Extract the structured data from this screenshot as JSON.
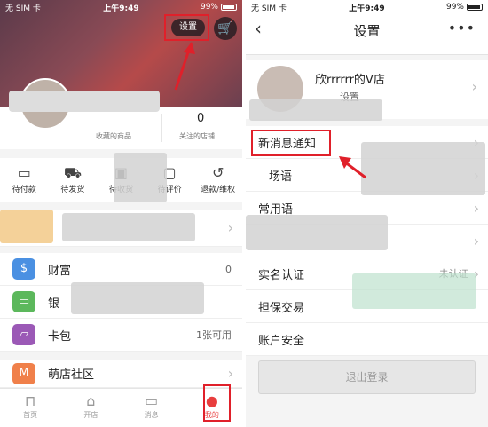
{
  "left": {
    "status": {
      "carrier": "无 SIM 卡",
      "time": "上午9:49",
      "battery": "99%"
    },
    "settings_button": "设置",
    "stats": {
      "favorites_count": "",
      "favorites_label": "收藏的商品",
      "following_count": "0",
      "following_label": "关注的店铺"
    },
    "orders": [
      {
        "label": "待付款",
        "icon": "wallet-icon"
      },
      {
        "label": "待发货",
        "icon": "truck-icon"
      },
      {
        "label": "待收货",
        "icon": "box-icon"
      },
      {
        "label": "待评价",
        "icon": "comment-icon"
      },
      {
        "label": "退款/维权",
        "icon": "refund-icon"
      }
    ],
    "menu": [
      {
        "label": "财富",
        "value": "0",
        "icon": "wealth-icon",
        "color": "#4a90e2"
      },
      {
        "label": "银",
        "value": "",
        "icon": "card-icon",
        "color": "#5cb85c"
      },
      {
        "label": "卡包",
        "value": "1张可用",
        "icon": "ticket-icon",
        "color": "#9b59b6"
      }
    ],
    "community": {
      "label": "萌店社区",
      "icon": "community-icon",
      "color": "#f0804a"
    },
    "tabs": [
      {
        "label": "首页",
        "icon": "bag-icon"
      },
      {
        "label": "开店",
        "icon": "store-icon"
      },
      {
        "label": "消息",
        "icon": "message-icon"
      },
      {
        "label": "我的",
        "icon": "person-icon"
      }
    ]
  },
  "right": {
    "status": {
      "carrier": "无 SIM 卡",
      "time": "上午9:49",
      "battery": "99%"
    },
    "title": "设置",
    "more": "•••",
    "store_name": "欣rrrrrr的V店",
    "store_sub": "设置",
    "rows": [
      {
        "label": "新消息通知",
        "value": ""
      },
      {
        "label": "ㅤ场语",
        "value": ""
      },
      {
        "label": "常用语",
        "value": ""
      },
      {
        "label": "",
        "value": ""
      },
      {
        "label": "实名认证",
        "value": "未认证"
      },
      {
        "label": "担保交易",
        "value": ""
      },
      {
        "label": "账户安全",
        "value": ""
      }
    ],
    "logout": "退出登录"
  },
  "colors": {
    "highlight": "#e0202a",
    "active_tab": "#e83e3e"
  }
}
